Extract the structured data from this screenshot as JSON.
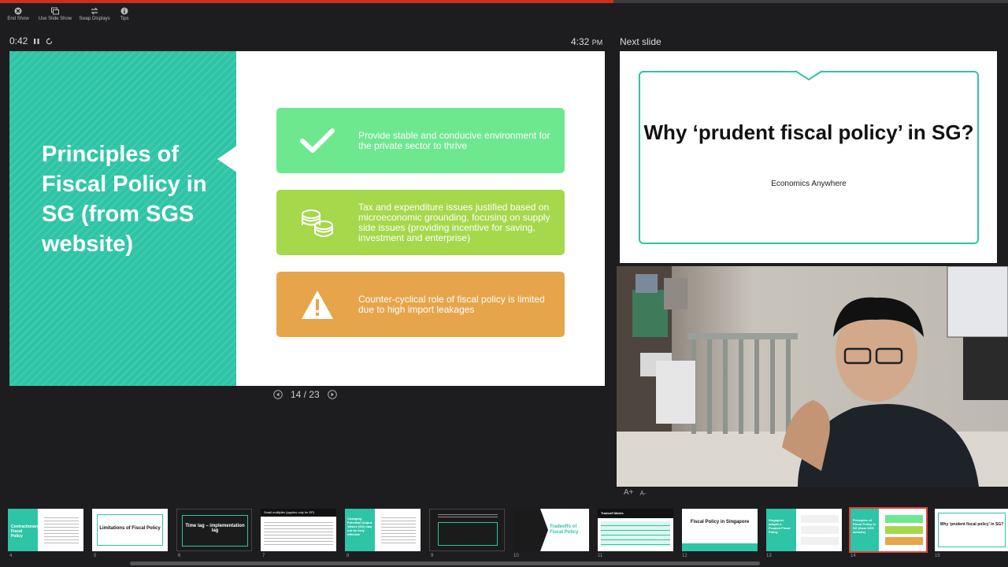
{
  "toolbar": {
    "items": [
      {
        "label": "End Show",
        "icon": "end-show-icon"
      },
      {
        "label": "Use Slide Show",
        "icon": "use-slide-show-icon"
      },
      {
        "label": "Swap Displays",
        "icon": "swap-displays-icon"
      },
      {
        "label": "Tips",
        "icon": "tips-icon"
      }
    ]
  },
  "timer": {
    "elapsed": "0:42",
    "time": "4:32",
    "ampm": "PM"
  },
  "next_slide_label": "Next slide",
  "current_slide": {
    "title": "Principles of Fiscal Policy in SG (from SGS website)",
    "cards": [
      {
        "icon": "checkmark-icon",
        "text": "Provide stable and conducive environment for the private sector to thrive",
        "color": "#6ee88f"
      },
      {
        "icon": "coins-icon",
        "text": "Tax and expenditure issues justified based on microeconomic grounding, focusing on supply side issues (providing incentive for saving, investment and enterprise)",
        "color": "#a5d84b"
      },
      {
        "icon": "warning-icon",
        "text": "Counter-cyclical role of fiscal policy is limited due to high import leakages",
        "color": "#e6a54a"
      }
    ]
  },
  "pager": {
    "label": "14 / 23"
  },
  "next_slide": {
    "title": "Why ‘prudent fiscal policy’ in SG?",
    "subtitle": "Economics Anywhere"
  },
  "font_controls": {
    "increase": "A+",
    "decrease": "A-"
  },
  "thumbnails": [
    {
      "num": "4",
      "text": "Contractionary Fiscal Policy"
    },
    {
      "num": "5",
      "text": "Limitations of Fiscal Policy"
    },
    {
      "num": "6",
      "text": "Time lag – implementation lag"
    },
    {
      "num": "7",
      "text": "Small multiplier (applies only for EP)"
    },
    {
      "num": "8",
      "text": "Changing Potential Output Values (SG) may not be truly effective"
    },
    {
      "num": "9",
      "text": ""
    },
    {
      "num": "10",
      "text": "Tradeoffs of Fiscal Policy"
    },
    {
      "num": "11",
      "text": "Tradeoff Matrix"
    },
    {
      "num": "12",
      "text": "Fiscal Policy in Singapore"
    },
    {
      "num": "13",
      "text": "Singapore adopts a Prudent Fiscal Policy"
    },
    {
      "num": "14",
      "text": "Principles of Fiscal Policy in SG (from SGS website)"
    },
    {
      "num": "15",
      "text": "Why ‘prudent fiscal policy’ in SG?"
    }
  ],
  "colors": {
    "accent": "#2ec4a6",
    "progress": "#d12c20",
    "selected": "#e2453a"
  },
  "progress": {
    "fraction": 0.609
  }
}
